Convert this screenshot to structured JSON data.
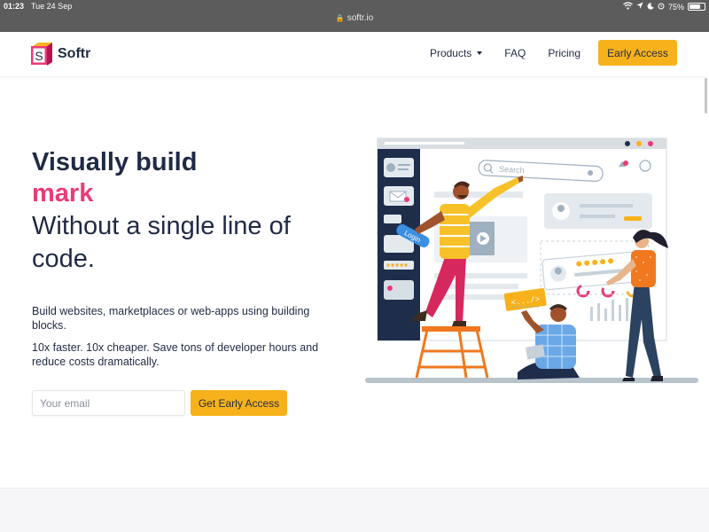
{
  "status_bar": {
    "time": "01:23",
    "date": "Tue 24 Sep",
    "url": "softr.io",
    "battery": "75%",
    "battery_level": 0.75
  },
  "navbar": {
    "brand": "Softr",
    "links": [
      "Products",
      "FAQ",
      "Pricing"
    ],
    "cta_label": "Early Access"
  },
  "hero": {
    "headline_line1": "Visually build",
    "headline_line2": "mark",
    "headline_line3": "Without a single line of code.",
    "paragraph1": "Build websites, marketplaces or web-apps using building blocks.",
    "paragraph2": "10x faster. 10x cheaper. Save tons of developer hours and reduce costs dramatically.",
    "email_placeholder": "Your email",
    "cta_label": "Get Early Access"
  },
  "illustration": {
    "search_placeholder": "Search",
    "login_tag": "Login",
    "code_tag": "<.../>",
    "rating_stars": 5
  },
  "colors": {
    "brand_yellow": "#f7b21b",
    "brand_pink": "#ea3b78",
    "text_navy": "#1f2a44",
    "sidebar_navy": "#1e2d4a"
  }
}
